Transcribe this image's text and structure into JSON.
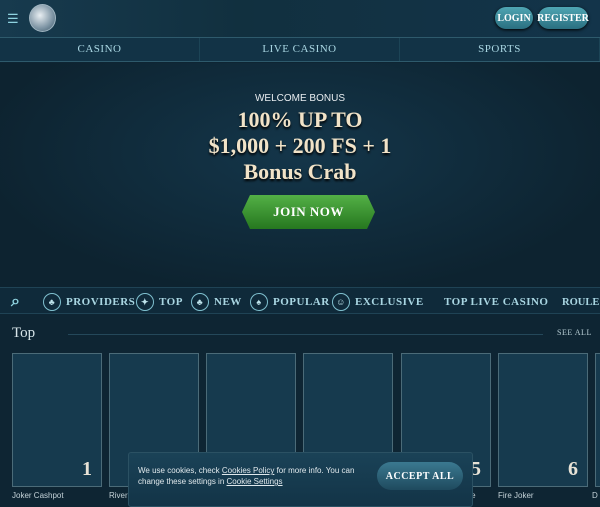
{
  "header": {
    "menu_icon": "menu-search-icon",
    "login": "LOGIN",
    "register": "REGISTER"
  },
  "nav": [
    "CASINO",
    "LIVE CASINO",
    "SPORTS"
  ],
  "hero": {
    "welcome": "WELCOME BONUS",
    "line1": "100% UP TO",
    "line2": "$1,000 + 200 FS + 1",
    "line3": "Bonus Crab",
    "join": "JOIN NOW"
  },
  "categories": [
    {
      "label": "PROVIDERS",
      "icon": "♣"
    },
    {
      "label": "TOP",
      "icon": "✦"
    },
    {
      "label": "NEW",
      "icon": "♣"
    },
    {
      "label": "POPULAR",
      "icon": "♠"
    },
    {
      "label": "EXCLUSIVE",
      "icon": "☺"
    },
    {
      "label": "TOP LIVE CASINO"
    },
    {
      "label": "ROULE"
    }
  ],
  "section": {
    "title": "Top",
    "see_all": "SEE ALL"
  },
  "games": [
    {
      "rank": "1",
      "name": "Joker Cashpot"
    },
    {
      "rank": "",
      "name": "River"
    },
    {
      "rank": "",
      "name": ""
    },
    {
      "rank": "",
      "name": ""
    },
    {
      "rank": "5",
      "name": "eme"
    },
    {
      "rank": "6",
      "name": "Fire Joker"
    },
    {
      "rank": "",
      "name": "D"
    }
  ],
  "cookie": {
    "t1": "We use cookies, check ",
    "link1": "Cookies Policy",
    "t2": " for more info. You can change these settings in ",
    "link2": "Cookie Settings",
    "accept": "ACCEPT ALL"
  },
  "colors": {
    "accent": "#4fa5b3",
    "join": "#3f9a35",
    "background": "#0e2533"
  }
}
